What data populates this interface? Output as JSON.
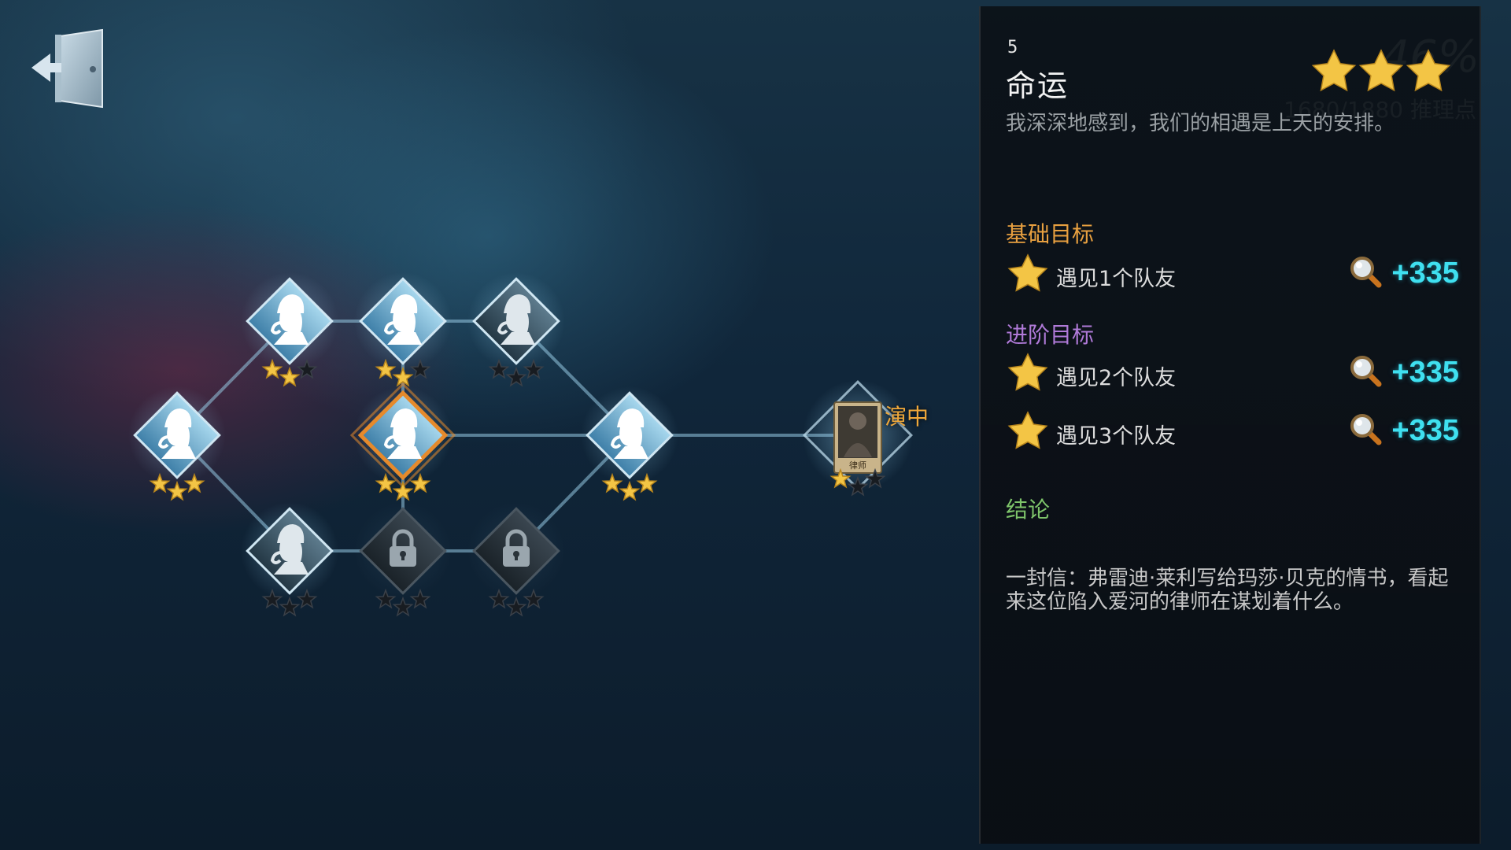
{
  "chapter": {
    "number": "5",
    "title": "命运",
    "quote": "我深深地感到，我们的相遇是上天的安排。",
    "rating": 3,
    "ghost_text": "46%",
    "ghost_subtext": "1680/1880 推理点"
  },
  "objectives": {
    "basic_title": "基础目标",
    "advanced_title": "进阶目标",
    "basic": [
      {
        "label": "遇见1个队友",
        "reward": "+335"
      }
    ],
    "advanced": [
      {
        "label": "遇见2个队友",
        "reward": "+335"
      },
      {
        "label": "遇见3个队友",
        "reward": "+335"
      }
    ]
  },
  "conclusion": {
    "title": "结论",
    "text": "一封信：弗雷迪·莱利写给玛莎·贝克的情书，看起来这位陷入爱河的律师在谋划着什么。"
  },
  "map": {
    "current_label": "演中",
    "current_card_caption": "律师",
    "nodes": [
      {
        "id": "n1",
        "state": "cleared",
        "stars": 3
      },
      {
        "id": "n2",
        "state": "cleared",
        "stars": 2
      },
      {
        "id": "n3",
        "state": "cleared",
        "stars": 2
      },
      {
        "id": "n4",
        "state": "cleared",
        "stars": 0
      },
      {
        "id": "n5",
        "state": "selected",
        "stars": 3
      },
      {
        "id": "n6",
        "state": "cleared",
        "stars": 3
      },
      {
        "id": "n7",
        "state": "cleared",
        "stars": 0
      },
      {
        "id": "n8",
        "state": "locked",
        "stars": 0
      },
      {
        "id": "n9",
        "state": "locked",
        "stars": 0
      },
      {
        "id": "n10",
        "state": "current",
        "stars": 1
      }
    ]
  },
  "colors": {
    "basic_title": "#e8a040",
    "advanced_title": "#b07ad8",
    "conclusion_title": "#7ec46a",
    "reward": "#3fe0f0",
    "current_label": "#f0a83a"
  },
  "icons": {
    "exit": "door-exit-icon",
    "reward": "magnifier-icon",
    "star": "star-icon",
    "lock": "lock-icon",
    "node": "detective-silhouette-icon"
  }
}
